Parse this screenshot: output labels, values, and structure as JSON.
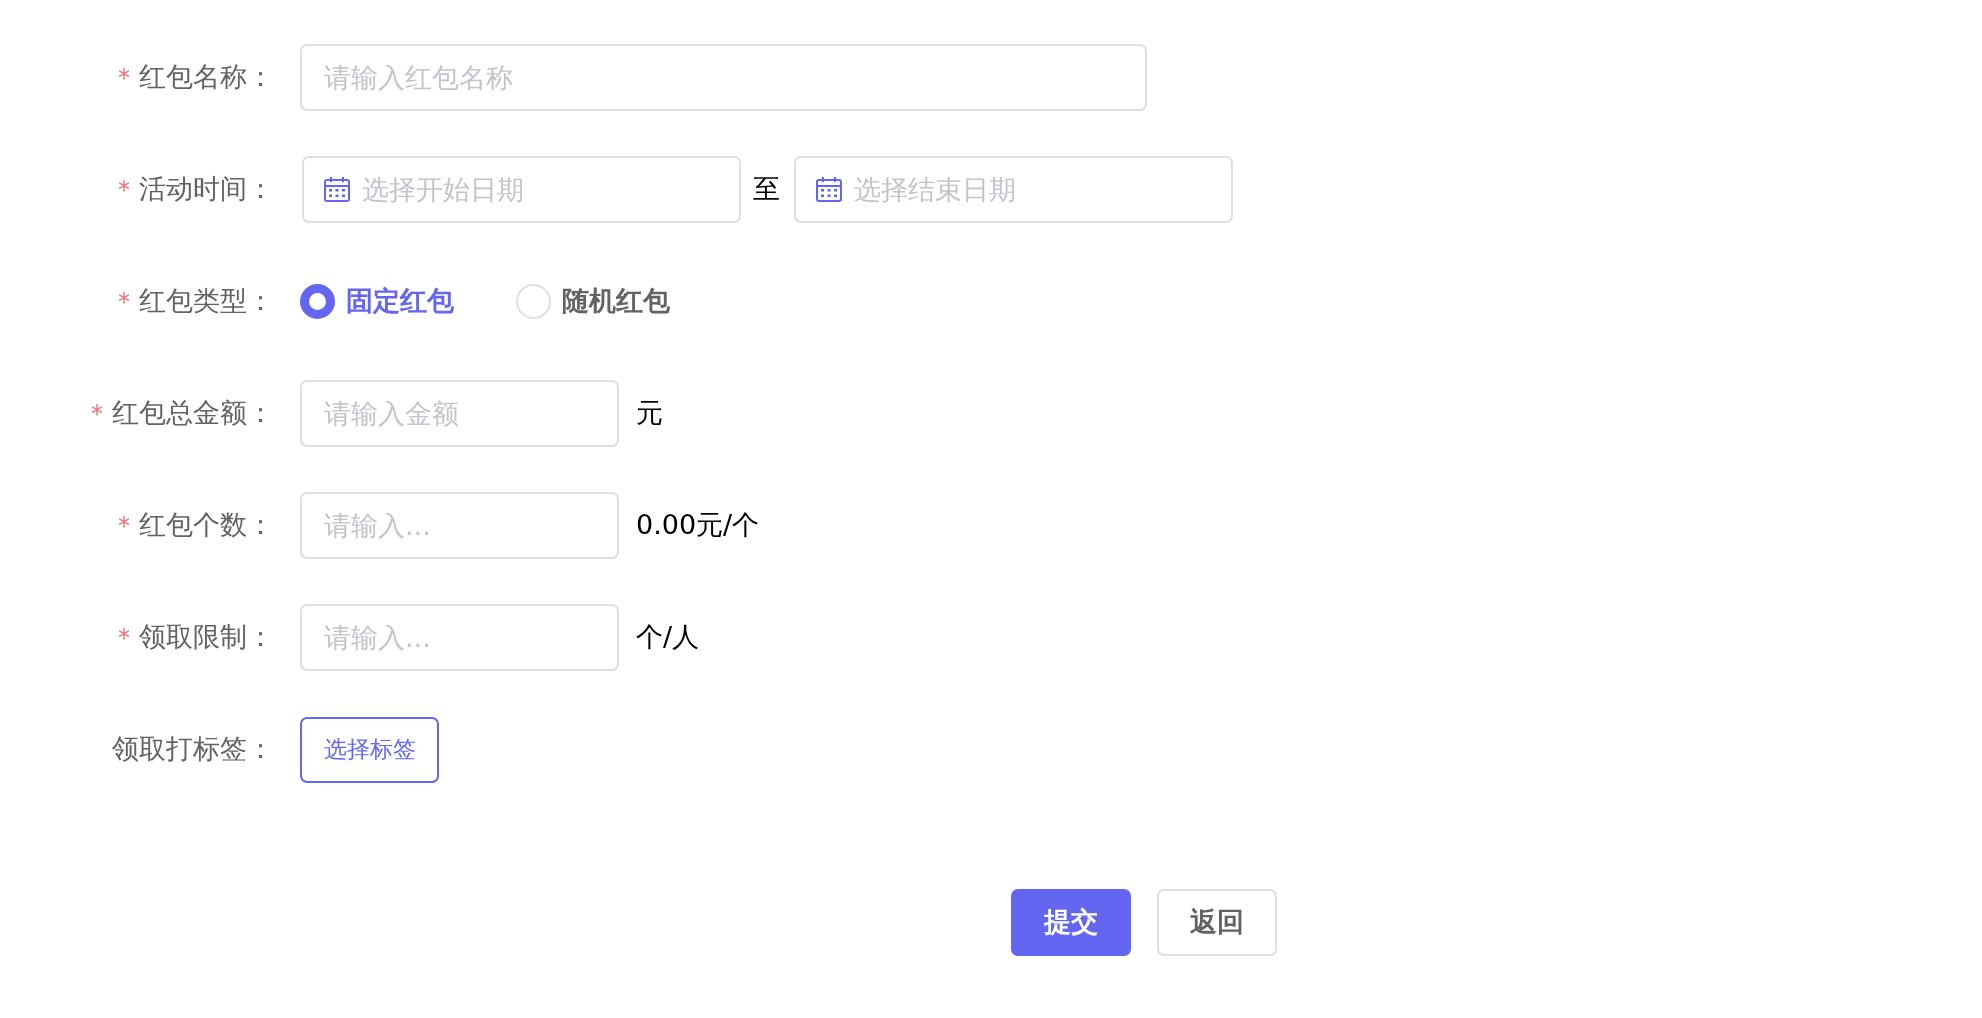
{
  "form": {
    "fields": [
      {
        "kind": "text",
        "required_mark": "*",
        "label": "红包名称：",
        "placeholder": "请输入红包名称"
      },
      {
        "kind": "daterange",
        "required_mark": "*",
        "label": "活动时间：",
        "start_placeholder": "选择开始日期",
        "separator": "至",
        "end_placeholder": "选择结束日期"
      },
      {
        "kind": "radio",
        "required_mark": "*",
        "label": "红包类型：",
        "options": [
          {
            "label": "固定红包",
            "selected": true
          },
          {
            "label": "随机红包",
            "selected": false
          }
        ]
      },
      {
        "kind": "number",
        "required_mark": "*",
        "label": "红包总金额：",
        "placeholder": "请输入金额",
        "suffix": "元"
      },
      {
        "kind": "number",
        "required_mark": "*",
        "label": "红包个数：",
        "placeholder": "请输入...",
        "suffix": "0.00元/个"
      },
      {
        "kind": "number",
        "required_mark": "*",
        "label": "领取限制：",
        "placeholder": "请输入...",
        "suffix": "个/人"
      },
      {
        "kind": "button",
        "label": "领取打标签：",
        "button": "选择标签"
      }
    ]
  },
  "actions": [
    {
      "kind": "primary",
      "label": "提交"
    },
    {
      "kind": "default",
      "label": "返回"
    }
  ]
}
